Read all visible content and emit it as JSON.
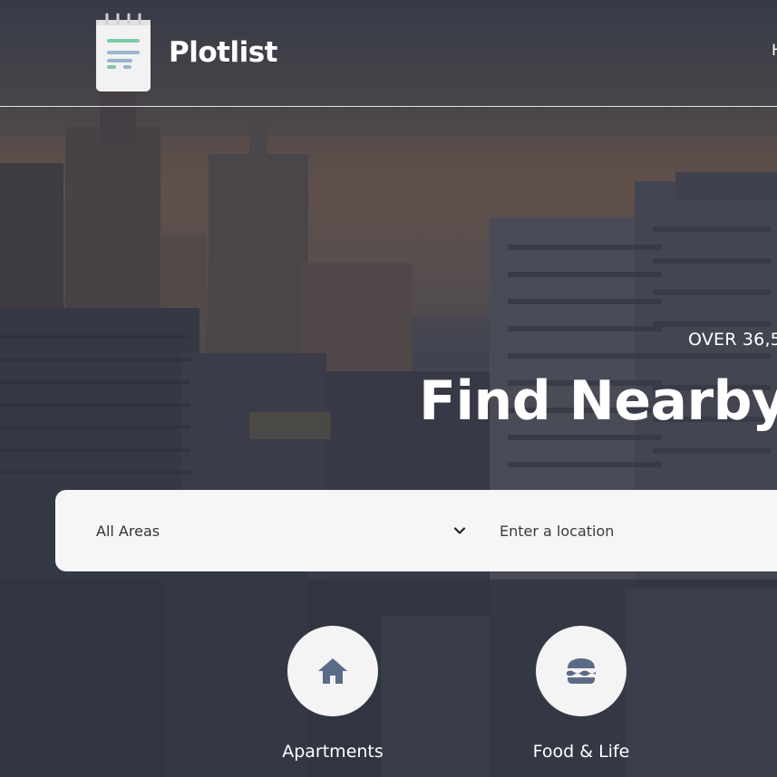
{
  "brand": {
    "name": "Plotlist"
  },
  "nav": {
    "partial_item": "H"
  },
  "hero": {
    "subtitle": "OVER 36,5",
    "title": "Find Nearby"
  },
  "search": {
    "area_select_value": "All Areas",
    "location_placeholder": "Enter a location"
  },
  "categories": [
    {
      "label": "Apartments",
      "icon": "home-icon"
    },
    {
      "label": "Food & Life",
      "icon": "burger-icon"
    }
  ],
  "colors": {
    "icon_fill": "#5b6b87",
    "logo_green": "#7ccaa6",
    "logo_blue": "#9cb4cf",
    "search_bg": "#f6f6f6"
  }
}
